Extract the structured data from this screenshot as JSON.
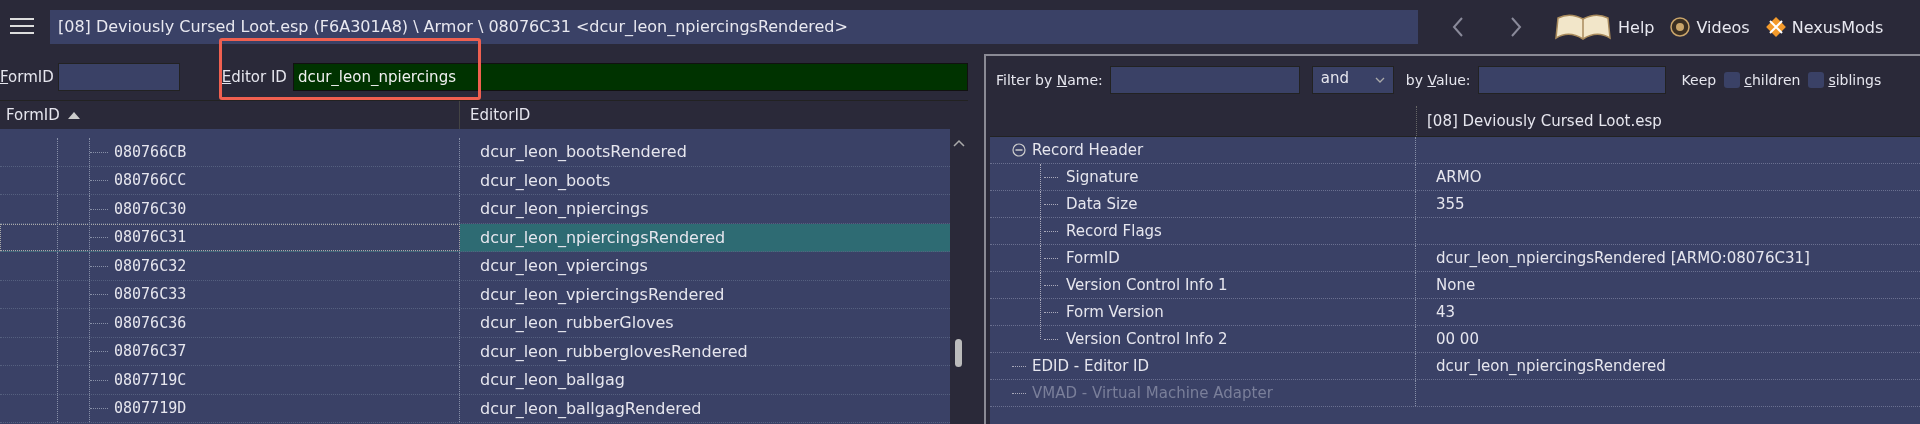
{
  "top_bar": {
    "path": "[08] Deviously Cursed Loot.esp (F6A301A8) \\ Armor \\ 08076C31 <dcur_leon_npiercingsRendered>",
    "nav": [
      {
        "kind": "back"
      },
      {
        "kind": "forward"
      }
    ],
    "links": [
      {
        "kind": "book",
        "label": "Help"
      },
      {
        "kind": "gp",
        "label": "Videos"
      },
      {
        "kind": "nexus",
        "label": "NexusMods"
      }
    ]
  },
  "left_panel": {
    "form_id_filter": {
      "label": {
        "key": "F",
        "rest": "ormID"
      }
    },
    "editor_id_filter": {
      "label": {
        "key": "E",
        "rest": "ditor ID"
      },
      "value": "dcur_leon_npiercings",
      "highlighted": true
    },
    "table": {
      "columns": [
        {
          "label": "FormID",
          "sorted": true
        },
        {
          "label": "EditorID",
          "sorted": false
        }
      ],
      "rows": [
        {
          "form_id": "080766CB",
          "editor_id": "dcur_leon_bootsRendered",
          "selected": false
        },
        {
          "form_id": "080766CC",
          "editor_id": "dcur_leon_boots",
          "selected": false
        },
        {
          "form_id": "08076C30",
          "editor_id": "dcur_leon_npiercings",
          "selected": false
        },
        {
          "form_id": "08076C31",
          "editor_id": "dcur_leon_npiercingsRendered",
          "selected": true
        },
        {
          "form_id": "08076C32",
          "editor_id": "dcur_leon_vpiercings",
          "selected": false
        },
        {
          "form_id": "08076C33",
          "editor_id": "dcur_leon_vpiercingsRendered",
          "selected": false
        },
        {
          "form_id": "08076C36",
          "editor_id": "dcur_leon_rubberGloves",
          "selected": false
        },
        {
          "form_id": "08076C37",
          "editor_id": "dcur_leon_rubberglovesRendered",
          "selected": false
        },
        {
          "form_id": "0807719C",
          "editor_id": "dcur_leon_ballgag",
          "selected": false
        },
        {
          "form_id": "0807719D",
          "editor_id": "dcur_leon_ballgagRendered",
          "selected": false
        }
      ]
    }
  },
  "right_panel": {
    "filter": {
      "name_label": {
        "before": "Filter by ",
        "key": "N",
        "after": "ame:"
      },
      "operator": "and",
      "value_label": {
        "before": "by ",
        "key": "V",
        "after": "alue:"
      },
      "keep_label": "Keep",
      "checkboxes": [
        {
          "label": {
            "key": "c",
            "rest": "hildren"
          },
          "checked": false
        },
        {
          "label": {
            "key": "s",
            "rest": "iblings"
          },
          "checked": false
        }
      ]
    },
    "columns": [
      {
        "label": "[08] Deviously Cursed Loot.esp"
      }
    ],
    "rows": [
      {
        "label": "Record Header",
        "expanded": true,
        "disabled": false,
        "children": [
          {
            "label": "Signature",
            "value": "ARMO"
          },
          {
            "label": "Data Size",
            "value": "355"
          },
          {
            "label": "Record Flags"
          },
          {
            "label": "FormID",
            "value": "dcur_leon_npiercingsRendered [ARMO:08076C31]"
          },
          {
            "label": "Version Control Info 1",
            "value": "None"
          },
          {
            "label": "Form Version",
            "value": "43"
          },
          {
            "label": "Version Control Info 2",
            "value": "00 00"
          }
        ]
      },
      {
        "label": "EDID - Editor ID",
        "value": "dcur_leon_npiercingsRendered",
        "disabled": false
      },
      {
        "label": "VMAD - Virtual Machine Adapter",
        "disabled": true
      }
    ]
  }
}
